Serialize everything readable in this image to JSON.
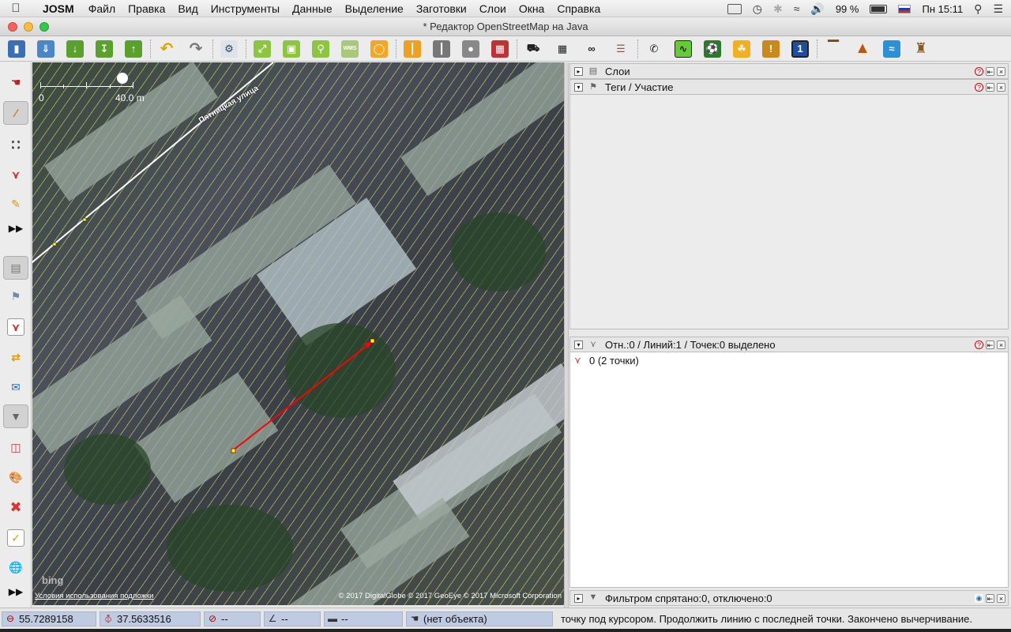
{
  "menubar": {
    "app": "JOSM",
    "menus": [
      "Файл",
      "Правка",
      "Вид",
      "Инструменты",
      "Данные",
      "Выделение",
      "Заготовки",
      "Слои",
      "Окна",
      "Справка"
    ],
    "battery": "99 %",
    "clock": "Пн 15:11"
  },
  "window": {
    "title": "* Редактор OpenStreetMap на Java"
  },
  "map": {
    "scale_start": "0",
    "scale_end": "40.0 m",
    "road_name": "Пятницкая улица",
    "bing_logo": "bing",
    "terms": "Условия использования подложки",
    "attribution": "© 2017 DigitalGlobe © 2017 GeoEye © 2017 Microsoft Corporation"
  },
  "panels": {
    "layers": {
      "title": "Слои"
    },
    "tags": {
      "title": "Теги / Участие"
    },
    "selection": {
      "title": "Отн.:0 / Линий:1 / Точек:0 выделено",
      "item": "0 (2 точки)"
    },
    "filter": {
      "title": "Фильтром спрятано:0, отключено:0"
    }
  },
  "status": {
    "lat": "55.7289158",
    "lon": "37.5633516",
    "heading": "--",
    "angle": "--",
    "distance": "--",
    "object": "(нет объекта)",
    "message": "точку под курсором. Продолжить линию с последней точки. Закончено вычерчивание."
  },
  "icons": {
    "toolbar": [
      "open-icon",
      "save-icon",
      "download-icon",
      "download-area-icon",
      "upload-icon",
      "undo-icon",
      "redo-icon",
      "preferences-icon",
      "zoom-to-data-icon",
      "zoom-selection-icon",
      "zoom-icon",
      "wms-tms-icon",
      "lasso-icon",
      "road-preset-icon",
      "track-preset-icon",
      "barrier-preset-icon",
      "wall-preset-icon",
      "car-preset-icon",
      "bus-preset-icon",
      "bicycle-preset-icon",
      "railway-preset-icon",
      "telephone-preset-icon",
      "leisure-preset-icon",
      "sports-preset-icon",
      "shop-preset-icon",
      "warning-preset-icon",
      "info-preset-icon",
      "industry-preset-icon",
      "mountain-preset-icon",
      "waterway-preset-icon",
      "castle-preset-icon"
    ],
    "tools": [
      "select-icon",
      "draw-icon",
      "zoom-icon",
      "improve-way-icon",
      "pencil-icon",
      "more-tools-icon",
      "layers-icon",
      "tags-icon",
      "selection-list-icon",
      "conflict-icon",
      "messages-icon",
      "filter-icon",
      "relations-icon",
      "map-style-icon",
      "delete-marker-icon",
      "validator-icon",
      "wikipedia-icon",
      "more-panels-icon"
    ]
  }
}
